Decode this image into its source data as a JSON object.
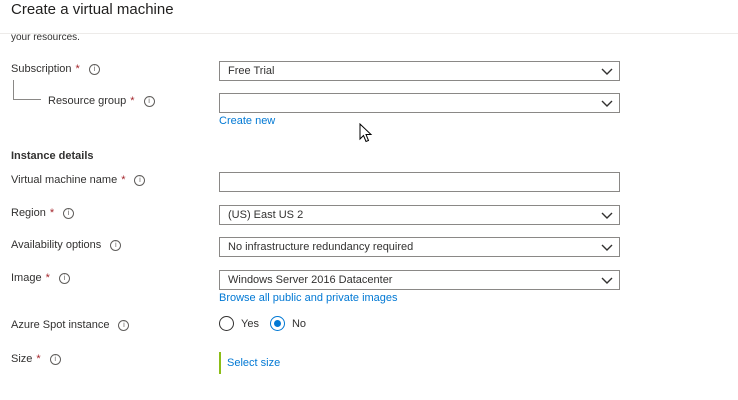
{
  "header": {
    "title": "Create a virtual machine"
  },
  "intro_fragment": "your resources.",
  "info_glyph": "i",
  "fields": {
    "subscription": {
      "label": "Subscription",
      "required_mark": "*",
      "value": "Free Trial"
    },
    "resource_group": {
      "label": "Resource group",
      "required_mark": "*",
      "value": "",
      "link": "Create new"
    },
    "vm_name": {
      "label": "Virtual machine name",
      "required_mark": "*",
      "value": ""
    },
    "region": {
      "label": "Region",
      "required_mark": "*",
      "value": "(US) East US 2"
    },
    "availability": {
      "label": "Availability options",
      "value": "No infrastructure redundancy required"
    },
    "image": {
      "label": "Image",
      "required_mark": "*",
      "value": "Windows Server 2016 Datacenter",
      "link": "Browse all public and private images"
    },
    "spot": {
      "label": "Azure Spot instance",
      "options": [
        "Yes",
        "No"
      ],
      "selected": "No"
    },
    "size": {
      "label": "Size",
      "required_mark": "*",
      "link": "Select size"
    }
  },
  "instance_section": {
    "title": "Instance details"
  },
  "colors": {
    "accent": "#0078d4",
    "required": "#a4262c",
    "size_bar": "#8cbd18"
  }
}
